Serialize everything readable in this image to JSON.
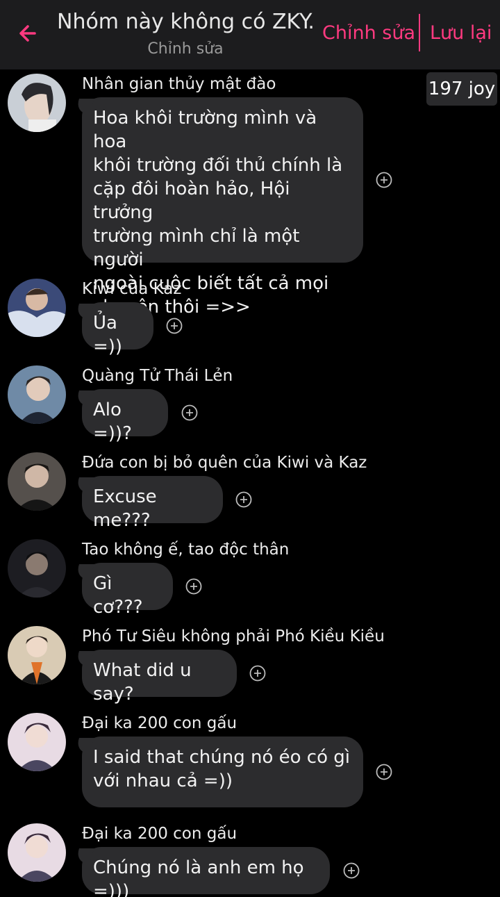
{
  "header": {
    "title": "Nhóm này không có ZKY...",
    "subtitle": "Chỉnh sửa",
    "edit_label": "Chỉnh sửa",
    "save_label": "Lưu lại",
    "accent_color": "#ff3a80"
  },
  "joy_badge": "197 joy",
  "messages": [
    {
      "sender": "Nhân gian thủy mật đào",
      "text": "Hoa khôi trường mình và hoa\nkhôi trường đối thủ chính là\ncặp đôi hoàn hảo, Hội trưởng\ntrường mình chỉ là một người\nngoài cuộc biết tất cả mọi\nchuyện thôi =>>"
    },
    {
      "sender": "Kiwi của Kaz",
      "text": "Ủa =))"
    },
    {
      "sender": "Quàng Tử Thái Lẻn",
      "text": "Alo =))?"
    },
    {
      "sender": "Đứa con bị bỏ quên của Kiwi và Kaz",
      "text": "Excuse me???"
    },
    {
      "sender": "Tao không ế, tao độc thân",
      "text": "Gì cơ???"
    },
    {
      "sender": "Phó Tư Siêu không phải Phó Kiều Kiều",
      "text": "What did u say?"
    },
    {
      "sender": "Đại ka 200 con gấu",
      "text": "I said that chúng nó éo có gì\nvới nhau cả =))"
    },
    {
      "sender": "Đại ka 200 con gấu",
      "text": "Chúng nó là anh em họ =)))"
    }
  ]
}
